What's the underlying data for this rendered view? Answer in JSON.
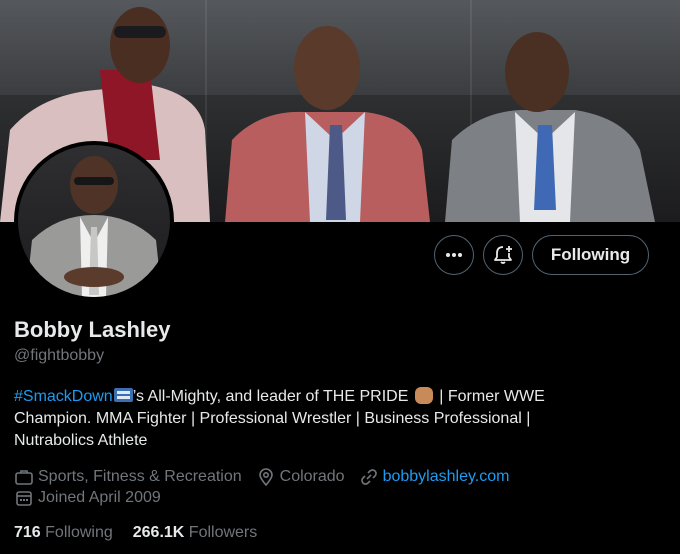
{
  "profile": {
    "name": "Bobby Lashley",
    "handle": "@fightbobby",
    "bio": {
      "hashtag": "#SmackDown",
      "part1": "’s All-Mighty, and leader of THE PRIDE",
      "part2": " | Former WWE Champion. MMA Fighter | Professional Wrestler | Business Professional | Nutrabolics Athlete"
    },
    "category": "Sports, Fitness & Recreation",
    "location": "Colorado",
    "website": "bobbylashley.com",
    "joined": "Joined April 2009"
  },
  "stats": {
    "following_count": "716",
    "following_label": "Following",
    "followers_count": "266.1K",
    "followers_label": "Followers"
  },
  "actions": {
    "following_button": "Following"
  },
  "colors": {
    "background": "#000000",
    "text": "#e7e9ea",
    "secondary_text": "#71767b",
    "link": "#1d9bf0",
    "border": "#536471"
  },
  "icons": [
    "more-icon",
    "notification-add-icon",
    "category-icon",
    "location-icon",
    "link-icon",
    "calendar-icon"
  ]
}
